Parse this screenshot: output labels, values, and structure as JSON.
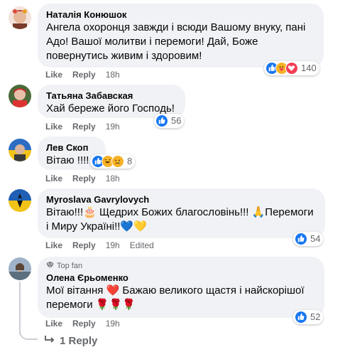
{
  "colors": {
    "bubble_bg": "#f0f2f5",
    "meta_text": "#65676b",
    "like_blue": "#1877f2",
    "love_red": "#f33e58",
    "haha_yellow": "#f7b125"
  },
  "comments": [
    {
      "author": "Наталія Конюшок",
      "lines": [
        "Ангела охоронця завжди і всюди Вашому внуку, пані",
        "Адо! Вашої молитви і перемоги! Дай, Боже",
        "повернутись живим і здоровим!"
      ],
      "like": "Like",
      "reply": "Reply",
      "time": "18h",
      "reactions": [
        "like",
        "care",
        "love"
      ],
      "reaction_count": "140"
    },
    {
      "author": "Татьяна Забавская",
      "lines": [
        "Хай береже його Господь!"
      ],
      "like": "Like",
      "reply": "Reply",
      "time": "19h",
      "reactions": [
        "like"
      ],
      "reaction_count": "56"
    },
    {
      "author": "Лев Скоп",
      "lines": [
        "Вітаю !!!!"
      ],
      "like": "Like",
      "reply": "Reply",
      "time": "18h",
      "reactions": [
        "like",
        "haha",
        "sad"
      ],
      "reaction_count": "8"
    },
    {
      "author": "Myroslava Gavrylovych",
      "lines": [
        "Вітаю!!!🎂 Щедрих Божих благословінь!!! 🙏Перемоги",
        "і Миру Україні!!💙💛"
      ],
      "like": "Like",
      "reply": "Reply",
      "time": "19h",
      "edited": "Edited",
      "reactions": [
        "like"
      ],
      "reaction_count": "54"
    },
    {
      "badge": "Top fan",
      "author": "Олена Єрьоменко",
      "lines": [
        "Мої вітання ❤️ Бажаю великого щастя і найскорішої",
        "перемоги 🌹🌹🌹"
      ],
      "like": "Like",
      "reply": "Reply",
      "time": "19h",
      "reactions": [
        "like"
      ],
      "reaction_count": "52"
    }
  ],
  "replies_link": "1 Reply",
  "icons": {
    "like": "thumbs-up-icon",
    "love": "heart-icon",
    "care": "hug-icon",
    "haha": "laughing-icon",
    "sad": "sad-face-icon",
    "top_fan": "diamond-badge-icon",
    "reply_arrow": "reply-arrow-icon"
  }
}
